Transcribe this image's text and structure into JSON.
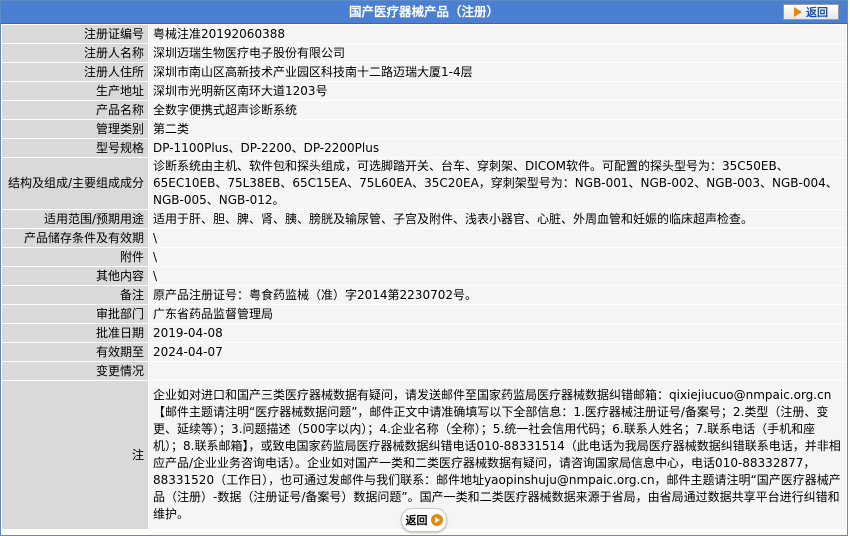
{
  "header": {
    "title": "国产医疗器械产品（注册）",
    "back_label": "返回"
  },
  "rows": [
    {
      "label": "注册证编号",
      "value": "粤械注准20192060388"
    },
    {
      "label": "注册人名称",
      "value": "深圳迈瑞生物医疗电子股份有限公司"
    },
    {
      "label": "注册人住所",
      "value": "深圳市南山区高新技术产业园区科技南十二路迈瑞大厦1-4层"
    },
    {
      "label": "生产地址",
      "value": "深圳市光明新区南环大道1203号"
    },
    {
      "label": "产品名称",
      "value": "全数字便携式超声诊断系统"
    },
    {
      "label": "管理类别",
      "value": "第二类"
    },
    {
      "label": "型号规格",
      "value": "DP-1100Plus、DP-2200、DP-2200Plus"
    },
    {
      "label": "结构及组成/主要组成成分",
      "value": "诊断系统由主机、软件包和探头组成，可选脚踏开关、台车、穿刺架、DICOM软件。可配置的探头型号为：35C50EB、65EC10EB、75L38EB、65C15EA、75L60EA、35C20EA，穿刺架型号为：NGB-001、NGB-002、NGB-003、NGB-004、NGB-005、NGB-012。"
    },
    {
      "label": "适用范围/预期用途",
      "value": "适用于肝、胆、脾、肾、胰、膀胱及输尿管、子宫及附件、浅表小器官、心脏、外周血管和妊娠的临床超声检查。"
    },
    {
      "label": "产品储存条件及有效期",
      "value": "\\"
    },
    {
      "label": "附件",
      "value": "\\"
    },
    {
      "label": "其他内容",
      "value": "\\"
    },
    {
      "label": "备注",
      "value": "原产品注册证号：粤食药监械（准）字2014第2230702号。"
    },
    {
      "label": "审批部门",
      "value": "广东省药品监督管理局"
    },
    {
      "label": "批准日期",
      "value": "2019-04-08"
    },
    {
      "label": "有效期至",
      "value": "2024-04-07"
    },
    {
      "label": "变更情况",
      "value": ""
    },
    {
      "label": "注",
      "value": "企业如对进口和国产三类医疗器械数据有疑问，请发送邮件至国家药监局医疗器械数据纠错邮箱：qixiejiucuo@nmpaic.org.cn【邮件主题请注明“医疗器械数据问题”，邮件正文中请准确填写以下全部信息：1.医疗器械注册证号/备案号；2.类型（注册、变更、延续等）；3.问题描述（500字以内）；4.企业名称（全称）；5.统一社会信用代码；6.联系人姓名；7.联系电话（手机和座机）；8.联系邮箱】，或致电国家药监局医疗器械数据纠错电话010-88331514（此电话为我局医疗器械数据纠错联系电话，并非相应产品/企业业务咨询电话）。企业如对国产一类和二类医疗器械数据有疑问，请咨询国家局信息中心，电话010-88332877，88331520（工作日），也可通过发邮件与我们联系：邮件地址yaopinshuju@nmpaic.org.cn，邮件主题请注明“国产医疗器械产品（注册）-数据（注册证号/备案号）数据问题”。国产一类和二类医疗器械数据来源于省局，由省局通过数据共享平台进行纠错和维护。"
    }
  ],
  "footer": {
    "back_label": "返回"
  }
}
